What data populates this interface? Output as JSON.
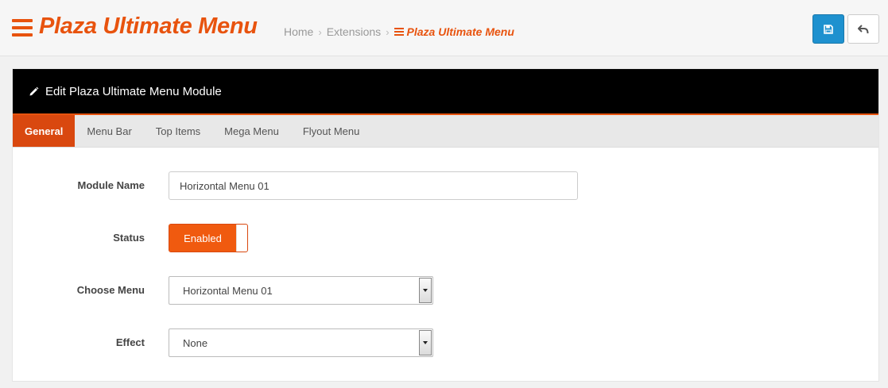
{
  "header": {
    "title": "Plaza Ultimate Menu",
    "breadcrumb": [
      {
        "label": "Home"
      },
      {
        "label": "Extensions"
      },
      {
        "label": "Plaza Ultimate Menu"
      }
    ],
    "save_button_icon": "save-icon",
    "back_button_icon": "reply-icon"
  },
  "panel": {
    "heading": "Edit Plaza Ultimate Menu Module",
    "heading_icon": "pencil-icon"
  },
  "tabs": [
    {
      "label": "General",
      "active": true
    },
    {
      "label": "Menu Bar",
      "active": false
    },
    {
      "label": "Top Items",
      "active": false
    },
    {
      "label": "Mega Menu",
      "active": false
    },
    {
      "label": "Flyout Menu",
      "active": false
    }
  ],
  "form": {
    "module_name": {
      "label": "Module Name",
      "value": "Horizontal Menu 01"
    },
    "status": {
      "label": "Status",
      "value": "Enabled"
    },
    "choose_menu": {
      "label": "Choose Menu",
      "value": "Horizontal Menu 01"
    },
    "effect": {
      "label": "Effect",
      "value": "None"
    }
  },
  "colors": {
    "accent": "#e8530e",
    "save_button": "#1e91cf",
    "heading_bg": "#000000",
    "active_tab": "#d9480f"
  }
}
